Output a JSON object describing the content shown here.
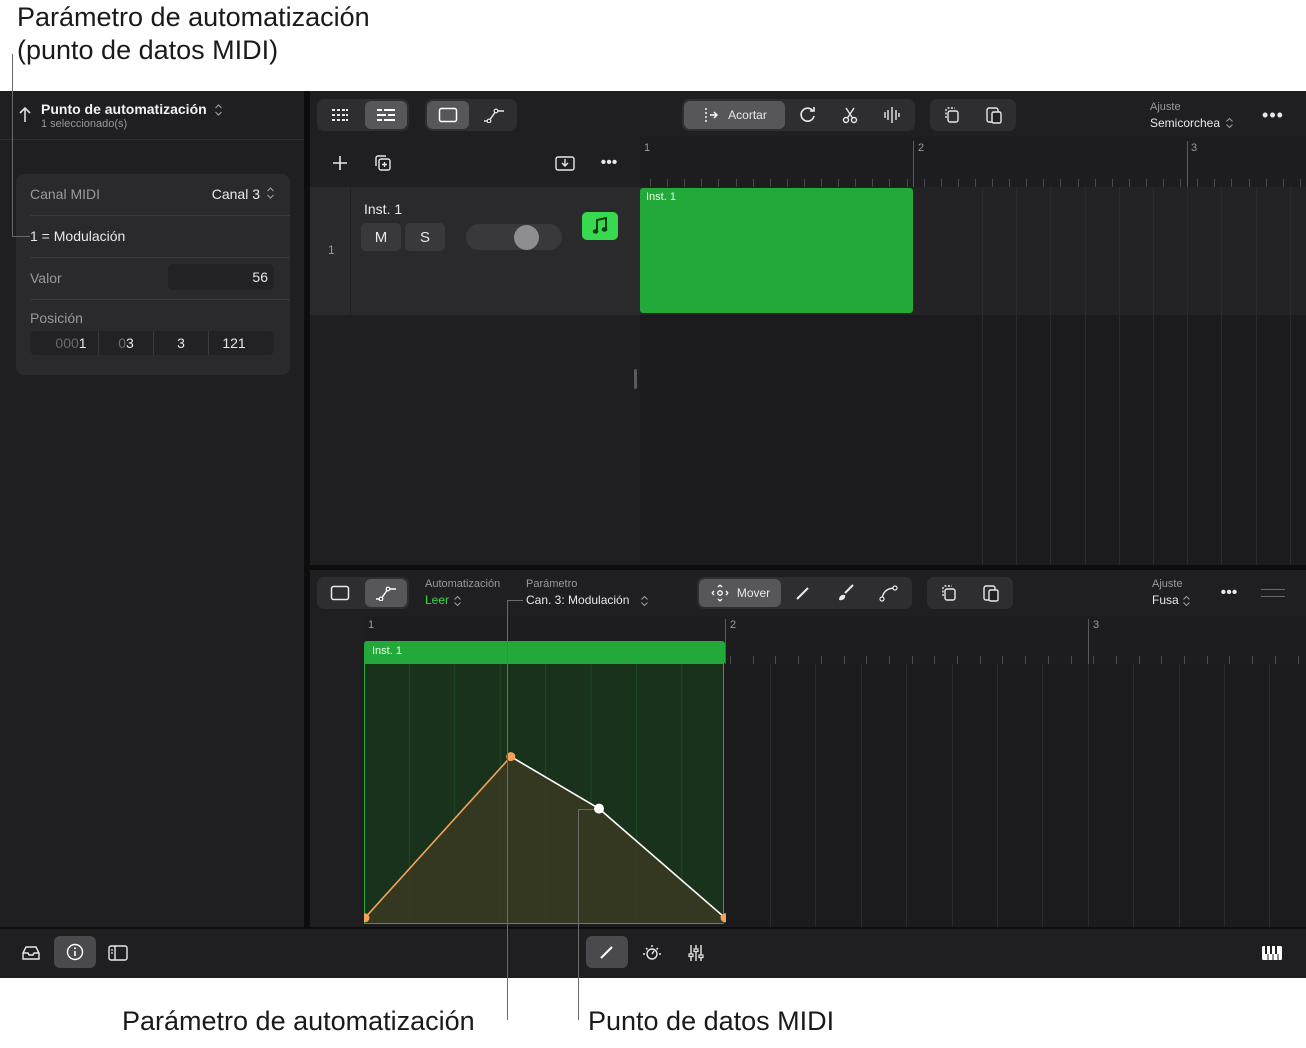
{
  "callouts": {
    "top_line1": "Parámetro de automatización",
    "top_line2": "(punto de datos MIDI)",
    "bottom_left": "Parámetro de automatización",
    "bottom_right": "Punto de datos MIDI"
  },
  "inspector": {
    "title": "Punto de automatización",
    "subtitle": "1 seleccionado(s)",
    "midi_channel_label": "Canal MIDI",
    "midi_channel_value": "Canal 3",
    "parameter": "1 = Modulación",
    "value_label": "Valor",
    "value": "56",
    "position_label": "Posición",
    "position": {
      "bar_prefix": "000",
      "bar": "1",
      "beat_prefix": "0",
      "beat": "3",
      "division": "3",
      "tick": "121"
    }
  },
  "toolbar": {
    "trim_label": "Acortar",
    "snap_label": "Ajuste",
    "snap_value": "Semicorchea"
  },
  "tracks": {
    "track_number": "1",
    "track_name": "Inst. 1",
    "mute_label": "M",
    "solo_label": "S",
    "region_name": "Inst. 1",
    "ruler": [
      "1",
      "2",
      "3"
    ]
  },
  "editor": {
    "automation_label": "Automatización",
    "automation_value": "Leer",
    "parameter_label": "Parámetro",
    "parameter_value": "Can. 3: Modulación",
    "move_label": "Mover",
    "snap_label": "Ajuste",
    "snap_value": "Fusa",
    "region_name": "Inst. 1",
    "ruler": [
      "1",
      "2",
      "3"
    ]
  },
  "automation_points": {
    "unit": "fraction of region (time) / fraction of lane height (value)",
    "points": [
      {
        "t": 0.0,
        "v": 0.02,
        "selected": true
      },
      {
        "t": 0.405,
        "v": 0.64,
        "selected": true
      },
      {
        "t": 0.65,
        "v": 0.44,
        "selected": false
      },
      {
        "t": 1.0,
        "v": 0.02,
        "selected": true
      }
    ]
  },
  "colors": {
    "region_green": "#22a93a",
    "automation_selected": "#f2a35a",
    "automation_line": "#ffffff",
    "active_green": "#37d94e"
  }
}
